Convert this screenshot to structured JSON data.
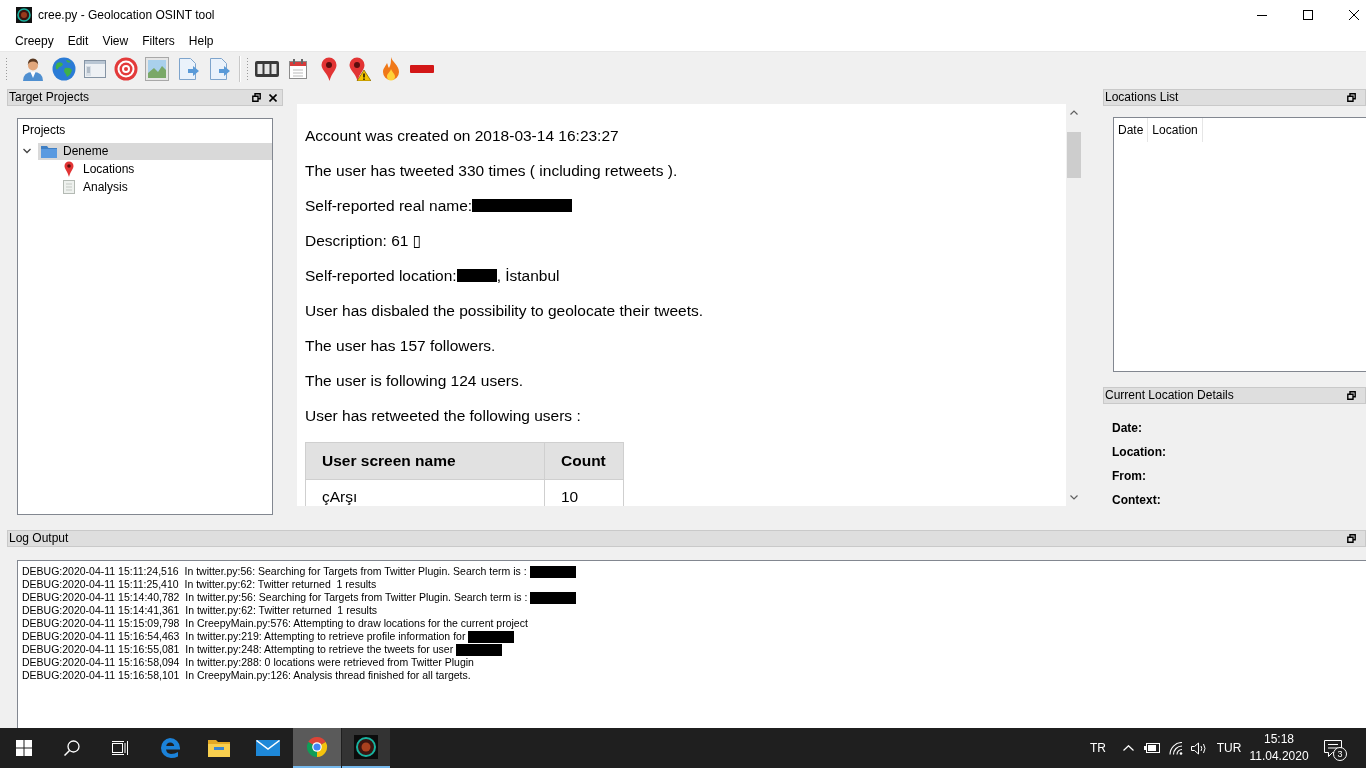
{
  "window": {
    "title": "cree.py - Geolocation OSINT tool"
  },
  "menu": [
    "Creepy",
    "Edit",
    "View",
    "Filters",
    "Help"
  ],
  "target_projects": {
    "title": "Target Projects",
    "tree": {
      "header": "Projects",
      "items": [
        {
          "label": "Deneme",
          "kind": "project",
          "expanded": true,
          "selected": true,
          "children": [
            {
              "label": "Locations",
              "kind": "locations",
              "selected": false
            },
            {
              "label": "Analysis",
              "kind": "analysis",
              "selected": false
            }
          ]
        }
      ]
    }
  },
  "analysis": {
    "paragraphs": [
      {
        "parts": [
          {
            "kind": "text",
            "text": "Account was created on 2018-03-14 16:23:27"
          }
        ]
      },
      {
        "parts": [
          {
            "kind": "text",
            "text": "The user has tweeted 330 times ( including retweets )."
          }
        ]
      },
      {
        "parts": [
          {
            "kind": "text",
            "text": "Self-reported real name:"
          },
          {
            "kind": "redaction"
          }
        ]
      },
      {
        "parts": [
          {
            "kind": "text",
            "text": "Description: 61 ▯"
          }
        ]
      },
      {
        "parts": [
          {
            "kind": "text",
            "text": "Self-reported location:"
          },
          {
            "kind": "redaction"
          },
          {
            "kind": "text",
            "text": ", İstanbul"
          }
        ]
      },
      {
        "parts": [
          {
            "kind": "text",
            "text": "User has disbaled the possibility to geolocate their tweets."
          }
        ]
      },
      {
        "parts": [
          {
            "kind": "text",
            "text": "The user has 157 followers."
          }
        ]
      },
      {
        "parts": [
          {
            "kind": "text",
            "text": "The user is following 124 users."
          }
        ]
      },
      {
        "parts": [
          {
            "kind": "text",
            "text": "User has retweeted the following users :"
          }
        ]
      }
    ],
    "table": {
      "columns": [
        "User screen name",
        "Count"
      ],
      "rows": [
        [
          "çArşı",
          "10"
        ]
      ]
    }
  },
  "locations_list": {
    "title": "Locations List",
    "columns": [
      "Date",
      "Location"
    ]
  },
  "location_details": {
    "title": "Current Location Details",
    "fields": [
      "Date:",
      "Location:",
      "From:",
      "Context:"
    ]
  },
  "log_output": {
    "title": "Log Output",
    "lines": [
      {
        "text": "DEBUG:2020-04-11 15:11:24,516  In twitter.py:56: Searching for Targets from Twitter Plugin. Search term is :",
        "redacted": true
      },
      {
        "text": "DEBUG:2020-04-11 15:11:25,410  In twitter.py:62: Twitter returned  1 results",
        "redacted": false
      },
      {
        "text": "DEBUG:2020-04-11 15:14:40,782  In twitter.py:56: Searching for Targets from Twitter Plugin. Search term is :",
        "redacted": true
      },
      {
        "text": "DEBUG:2020-04-11 15:14:41,361  In twitter.py:62: Twitter returned  1 results",
        "redacted": false
      },
      {
        "text": "DEBUG:2020-04-11 15:15:09,798  In CreepyMain.py:576: Attempting to draw locations for the current project",
        "redacted": false
      },
      {
        "text": "DEBUG:2020-04-11 15:16:54,463  In twitter.py:219: Attempting to retrieve profile information for",
        "redacted": true
      },
      {
        "text": "DEBUG:2020-04-11 15:16:55,081  In twitter.py:248: Attempting to retrieve the tweets for user",
        "redacted": true
      },
      {
        "text": "DEBUG:2020-04-11 15:16:58,094  In twitter.py:288: 0 locations were retrieved from Twitter Plugin",
        "redacted": false
      },
      {
        "text": "DEBUG:2020-04-11 15:16:58,101  In CreepyMain.py:126: Analysis thread finished for all targets.",
        "redacted": false
      }
    ]
  },
  "taskbar": {
    "apps": [
      {
        "kind": "edge",
        "running": false,
        "selected": false
      },
      {
        "kind": "explorer",
        "running": false,
        "selected": false
      },
      {
        "kind": "mail",
        "running": false,
        "selected": false
      },
      {
        "kind": "chrome",
        "running": true,
        "selected": true
      },
      {
        "kind": "creepy",
        "running": true,
        "selected": false
      }
    ],
    "language": "TR",
    "keyboard": "TUR",
    "time": "15:18",
    "date": "11.04.2020",
    "notifications": "3"
  }
}
